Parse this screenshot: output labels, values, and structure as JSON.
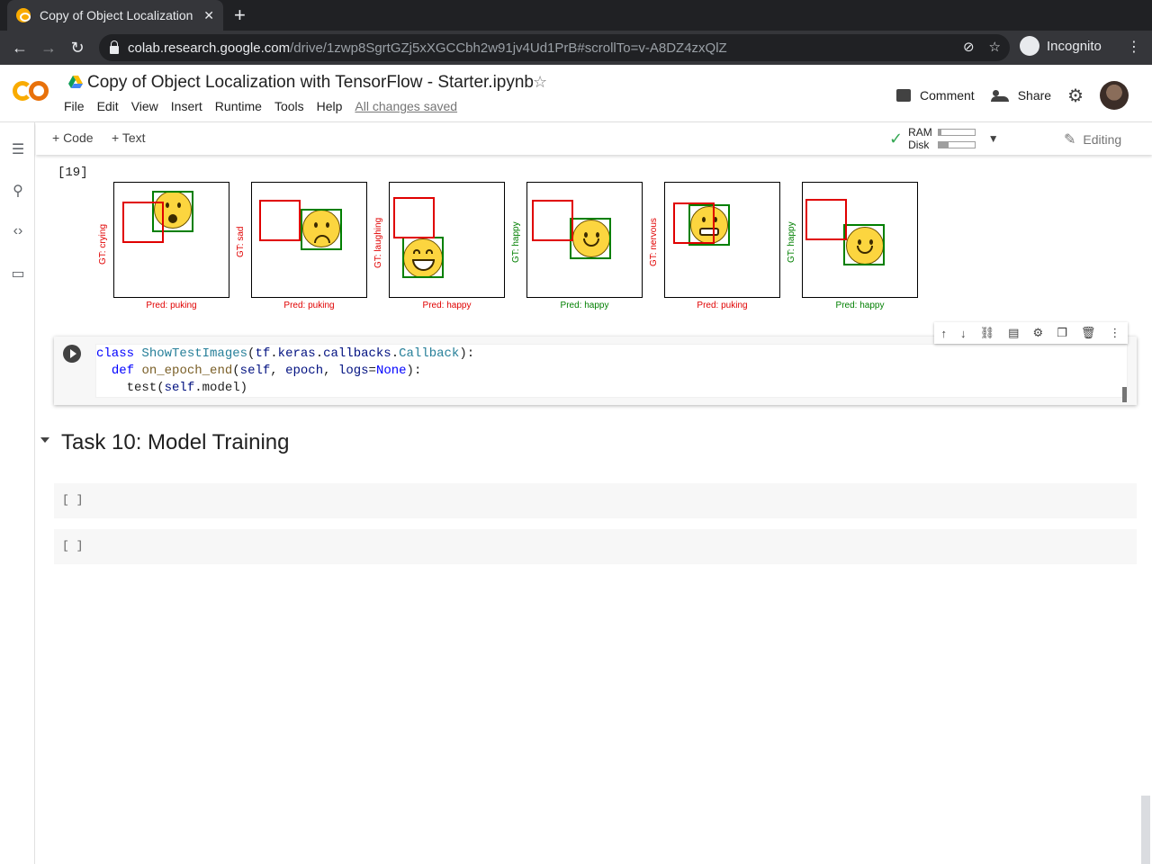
{
  "browser": {
    "tab_title": "Copy of Object Localization",
    "new_tab_label": "+",
    "url_host": "colab.research.google.com",
    "url_path": "/drive/1zwp8SgrtGZj5xXGCCbh2w91jv4Ud1PrB#scrollTo=v-A8DZ4zxQlZ",
    "profile_label": "Incognito"
  },
  "colab": {
    "notebook_title": "Copy of Object Localization with TensorFlow - Starter.ipynb",
    "menu": [
      "File",
      "Edit",
      "View",
      "Insert",
      "Runtime",
      "Tools",
      "Help"
    ],
    "save_status": "All changes saved",
    "comment_label": "Comment",
    "share_label": "Share"
  },
  "cellbar": {
    "add_code_label": "+ Code",
    "add_text_label": "+ Text",
    "ram_label": "RAM",
    "disk_label": "Disk",
    "ram_usage_fraction": 0.08,
    "disk_usage_fraction": 0.28,
    "editing_label": "Editing"
  },
  "output_cell": {
    "execution_count": "[19]",
    "panels": [
      {
        "gt": "GT: crying",
        "gt_color": "red",
        "pred": "Pred: puking",
        "pred_color": "red",
        "emoji": "crying-face"
      },
      {
        "gt": "GT: sad",
        "gt_color": "red",
        "pred": "Pred: puking",
        "pred_color": "red",
        "emoji": "sad-face"
      },
      {
        "gt": "GT: laughing",
        "gt_color": "red",
        "pred": "Pred: happy",
        "pred_color": "red",
        "emoji": "laughing-face"
      },
      {
        "gt": "GT: happy",
        "gt_color": "green",
        "pred": "Pred: happy",
        "pred_color": "green",
        "emoji": "smiling-face"
      },
      {
        "gt": "GT: nervous",
        "gt_color": "red",
        "pred": "Pred: puking",
        "pred_color": "red",
        "emoji": "grimacing-face"
      },
      {
        "gt": "GT: happy",
        "gt_color": "green",
        "pred": "Pred: happy",
        "pred_color": "green",
        "emoji": "smiling-face"
      }
    ]
  },
  "code_cell": {
    "lines": [
      "class ShowTestImages(tf.keras.callbacks.Callback):",
      "  def on_epoch_end(self, epoch, logs=None):",
      "    test(self.model)"
    ]
  },
  "section": {
    "title": "Task 10: Model Training"
  },
  "empty_cells": [
    "[ ]",
    "[ ]"
  ],
  "colors": {
    "red": "#e00000",
    "green": "#007f00",
    "colab_orange": "#f9ab00"
  }
}
